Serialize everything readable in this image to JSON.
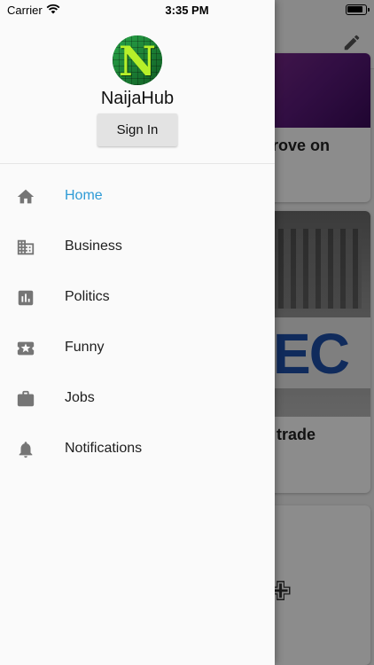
{
  "status_bar": {
    "carrier": "Carrier",
    "time": "3:35 PM"
  },
  "drawer": {
    "app_name": "NaijaHub",
    "avatar_letter": "N",
    "sign_in_label": "Sign In",
    "menu": [
      {
        "label": "Home",
        "icon": "home-icon",
        "active": true
      },
      {
        "label": "Business",
        "icon": "building-icon",
        "active": false
      },
      {
        "label": "Politics",
        "icon": "bar-chart-icon",
        "active": false
      },
      {
        "label": "Funny",
        "icon": "star-ticket-icon",
        "active": false
      },
      {
        "label": "Jobs",
        "icon": "briefcase-icon",
        "active": false
      },
      {
        "label": "Notifications",
        "icon": "bell-icon",
        "active": false
      }
    ]
  },
  "background": {
    "cards": [
      {
        "title_fragment": "prove on"
      },
      {
        "title_fragment": "n trade",
        "image_text": "EC"
      }
    ]
  },
  "colors": {
    "accent": "#2f9bd6",
    "icon": "#757575",
    "drawer_bg": "#fafafa"
  }
}
